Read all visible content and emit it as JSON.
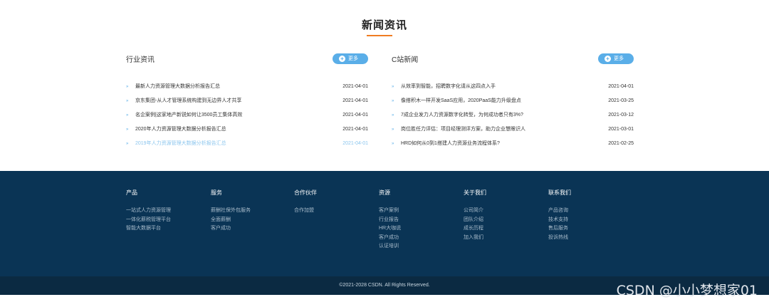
{
  "news": {
    "title": "新闻资讯",
    "accent_color": "#f07c22",
    "left": {
      "title": "行业资讯",
      "more_label": "更多",
      "items": [
        {
          "text": "最新人力资源管理大数据分析报告汇总",
          "date": "2021-04-01"
        },
        {
          "text": "京东集团-从人才管理系统构建到无边界人才共享",
          "date": "2021-04-01"
        },
        {
          "text": "名企案例|这家地产新锐如何让3500员工集体高效",
          "date": "2021-04-01"
        },
        {
          "text": "2020年人力资源管理大数据分析报告汇总",
          "date": "2021-04-01"
        },
        {
          "text": "2019年人力资源管理大数据分析报告汇总",
          "date": "2021-04-01"
        }
      ]
    },
    "right": {
      "title": "C站新闻",
      "more_label": "更多",
      "items": [
        {
          "text": "从效率到智能，招聘数字化请从这四点入手",
          "date": "2021-04-01"
        },
        {
          "text": "像搭积木一样开发SaaS应用，2020PaaS能力升级盘点",
          "date": "2021-03-25"
        },
        {
          "text": "7成企业发力人力资源数字化转型，为何成功者只有3%?",
          "date": "2021-03-12"
        },
        {
          "text": "岗位胜任力评估：项目经理测评方案，助力企业慧眼识人",
          "date": "2021-03-01"
        },
        {
          "text": "HRD如何从0到1搭建人力资源业务流程体系?",
          "date": "2021-02-25"
        }
      ]
    }
  },
  "footer": {
    "columns": [
      {
        "title": "产品",
        "links": [
          "一站式人力资源管理",
          "一体化薪税管理平台",
          "智能大数据平台"
        ]
      },
      {
        "title": "服务",
        "links": [
          "薪酬社保外包服务",
          "全面薪酬",
          "客户成功"
        ]
      },
      {
        "title": "合作伙伴",
        "links": [
          "合作加盟"
        ]
      },
      {
        "title": "资源",
        "links": [
          "客户案例",
          "行业报告",
          "HR大咖说",
          "客户成功",
          "认证培训"
        ]
      },
      {
        "title": "关于我们",
        "links": [
          "公司简介",
          "团队介绍",
          "成长历程",
          "加入我们"
        ]
      },
      {
        "title": "联系我们",
        "links": [
          "产品咨询",
          "技术支持",
          "售后服务",
          "投诉热线"
        ]
      }
    ],
    "copyright": "©2021-2028 CSDN. All Rights Reserved."
  },
  "watermark": "CSDN @小小梦想家01",
  "colors": {
    "footer_bg": "#0a3455",
    "button_bg": "#5aaee8",
    "link_active": "#8cc6ee"
  }
}
